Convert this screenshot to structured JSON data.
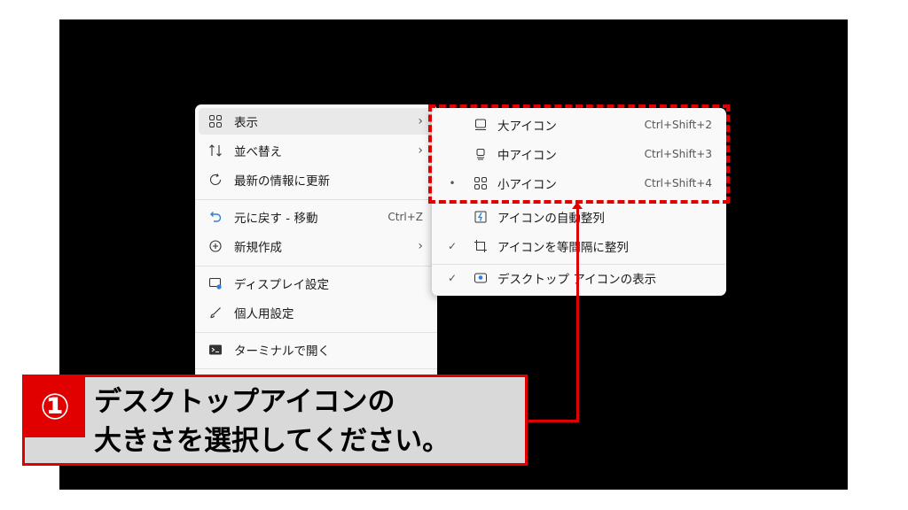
{
  "main_menu": {
    "items": [
      {
        "icon": "grid-icon",
        "label": "表示",
        "has_submenu": true,
        "highlighted": true
      },
      {
        "icon": "sort-icon",
        "label": "並べ替え",
        "has_submenu": true
      },
      {
        "icon": "refresh-icon",
        "label": "最新の情報に更新"
      },
      {
        "icon": "undo-icon",
        "label": "元に戻す - 移動",
        "shortcut": "Ctrl+Z"
      },
      {
        "icon": "new-plus-icon",
        "label": "新規作成",
        "has_submenu": true
      },
      {
        "icon": "display-settings-icon",
        "label": "ディスプレイ設定"
      },
      {
        "icon": "brush-icon",
        "label": "個人用設定"
      },
      {
        "icon": "terminal-icon",
        "label": "ターミナルで開く"
      }
    ]
  },
  "sub_menu": {
    "items": [
      {
        "icon": "large-icon",
        "label": "大アイコン",
        "shortcut": "Ctrl+Shift+2"
      },
      {
        "icon": "medium-icon",
        "label": "中アイコン",
        "shortcut": "Ctrl+Shift+3"
      },
      {
        "icon": "small-icon",
        "label": "小アイコン",
        "shortcut": "Ctrl+Shift+4",
        "mark": "•"
      },
      {
        "icon": "auto-arrange-icon",
        "label": "アイコンの自動整列"
      },
      {
        "icon": "align-grid-icon",
        "label": "アイコンを等間隔に整列",
        "mark": "✓"
      },
      {
        "icon": "show-desktop-icons-icon",
        "label": "デスクトップ アイコンの表示",
        "mark": "✓"
      }
    ]
  },
  "callout": {
    "number": "①",
    "line1": "デスクトップアイコンの",
    "line2": "大きさを選択してください。"
  },
  "colors": {
    "accent": "#e00000",
    "desktop": "#000000",
    "menu": "#f9f9f9"
  }
}
